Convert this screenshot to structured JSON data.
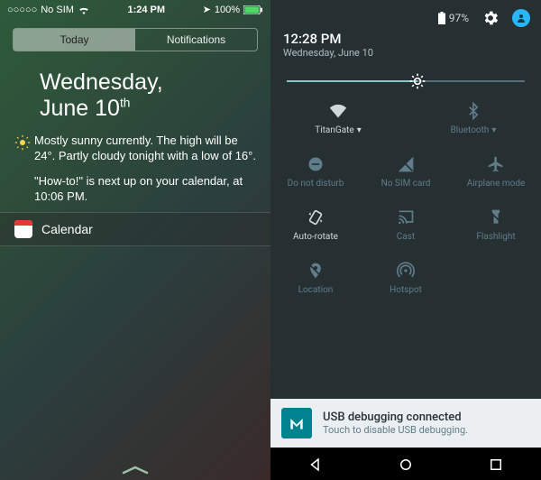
{
  "ios": {
    "status": {
      "carrier": "No SIM",
      "time": "1:24 PM",
      "battery": "100%"
    },
    "tabs": {
      "today": "Today",
      "notifications": "Notifications"
    },
    "date_weekday": "Wednesday,",
    "date_month_day": "June 10",
    "date_ordinal": "th",
    "weather_line": "Mostly sunny currently. The high will be 24°. Partly cloudy tonight with a low of 16°.",
    "calendar_line": "\"How-to!\" is next up on your calendar, at 10:06 PM.",
    "calendar_row": "Calendar"
  },
  "android": {
    "battery": "97%",
    "time": "12:28 PM",
    "date": "Wednesday, June 10",
    "tiles": {
      "wifi": "TitanGate",
      "bluetooth": "Bluetooth",
      "dnd": "Do not disturb",
      "sim": "No SIM card",
      "airplane": "Airplane mode",
      "rotate": "Auto-rotate",
      "cast": "Cast",
      "flash": "Flashlight",
      "location": "Location",
      "hotspot": "Hotspot"
    },
    "notif_title": "USB debugging connected",
    "notif_sub": "Touch to disable USB debugging."
  }
}
